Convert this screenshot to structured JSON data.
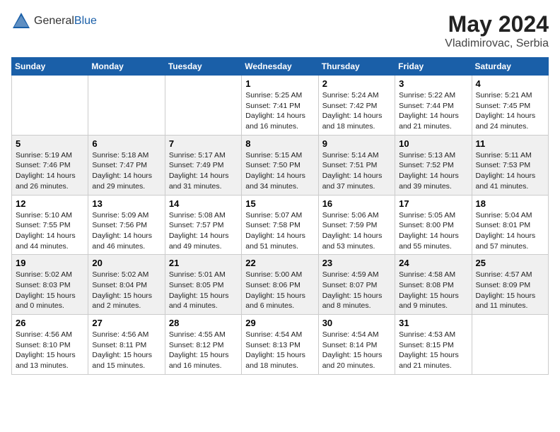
{
  "header": {
    "logo_general": "General",
    "logo_blue": "Blue",
    "month_year": "May 2024",
    "location": "Vladimirovac, Serbia"
  },
  "weekdays": [
    "Sunday",
    "Monday",
    "Tuesday",
    "Wednesday",
    "Thursday",
    "Friday",
    "Saturday"
  ],
  "weeks": [
    [
      {
        "day": "",
        "info": ""
      },
      {
        "day": "",
        "info": ""
      },
      {
        "day": "",
        "info": ""
      },
      {
        "day": "1",
        "info": "Sunrise: 5:25 AM\nSunset: 7:41 PM\nDaylight: 14 hours and 16 minutes."
      },
      {
        "day": "2",
        "info": "Sunrise: 5:24 AM\nSunset: 7:42 PM\nDaylight: 14 hours and 18 minutes."
      },
      {
        "day": "3",
        "info": "Sunrise: 5:22 AM\nSunset: 7:44 PM\nDaylight: 14 hours and 21 minutes."
      },
      {
        "day": "4",
        "info": "Sunrise: 5:21 AM\nSunset: 7:45 PM\nDaylight: 14 hours and 24 minutes."
      }
    ],
    [
      {
        "day": "5",
        "info": "Sunrise: 5:19 AM\nSunset: 7:46 PM\nDaylight: 14 hours and 26 minutes."
      },
      {
        "day": "6",
        "info": "Sunrise: 5:18 AM\nSunset: 7:47 PM\nDaylight: 14 hours and 29 minutes."
      },
      {
        "day": "7",
        "info": "Sunrise: 5:17 AM\nSunset: 7:49 PM\nDaylight: 14 hours and 31 minutes."
      },
      {
        "day": "8",
        "info": "Sunrise: 5:15 AM\nSunset: 7:50 PM\nDaylight: 14 hours and 34 minutes."
      },
      {
        "day": "9",
        "info": "Sunrise: 5:14 AM\nSunset: 7:51 PM\nDaylight: 14 hours and 37 minutes."
      },
      {
        "day": "10",
        "info": "Sunrise: 5:13 AM\nSunset: 7:52 PM\nDaylight: 14 hours and 39 minutes."
      },
      {
        "day": "11",
        "info": "Sunrise: 5:11 AM\nSunset: 7:53 PM\nDaylight: 14 hours and 41 minutes."
      }
    ],
    [
      {
        "day": "12",
        "info": "Sunrise: 5:10 AM\nSunset: 7:55 PM\nDaylight: 14 hours and 44 minutes."
      },
      {
        "day": "13",
        "info": "Sunrise: 5:09 AM\nSunset: 7:56 PM\nDaylight: 14 hours and 46 minutes."
      },
      {
        "day": "14",
        "info": "Sunrise: 5:08 AM\nSunset: 7:57 PM\nDaylight: 14 hours and 49 minutes."
      },
      {
        "day": "15",
        "info": "Sunrise: 5:07 AM\nSunset: 7:58 PM\nDaylight: 14 hours and 51 minutes."
      },
      {
        "day": "16",
        "info": "Sunrise: 5:06 AM\nSunset: 7:59 PM\nDaylight: 14 hours and 53 minutes."
      },
      {
        "day": "17",
        "info": "Sunrise: 5:05 AM\nSunset: 8:00 PM\nDaylight: 14 hours and 55 minutes."
      },
      {
        "day": "18",
        "info": "Sunrise: 5:04 AM\nSunset: 8:01 PM\nDaylight: 14 hours and 57 minutes."
      }
    ],
    [
      {
        "day": "19",
        "info": "Sunrise: 5:02 AM\nSunset: 8:03 PM\nDaylight: 15 hours and 0 minutes."
      },
      {
        "day": "20",
        "info": "Sunrise: 5:02 AM\nSunset: 8:04 PM\nDaylight: 15 hours and 2 minutes."
      },
      {
        "day": "21",
        "info": "Sunrise: 5:01 AM\nSunset: 8:05 PM\nDaylight: 15 hours and 4 minutes."
      },
      {
        "day": "22",
        "info": "Sunrise: 5:00 AM\nSunset: 8:06 PM\nDaylight: 15 hours and 6 minutes."
      },
      {
        "day": "23",
        "info": "Sunrise: 4:59 AM\nSunset: 8:07 PM\nDaylight: 15 hours and 8 minutes."
      },
      {
        "day": "24",
        "info": "Sunrise: 4:58 AM\nSunset: 8:08 PM\nDaylight: 15 hours and 9 minutes."
      },
      {
        "day": "25",
        "info": "Sunrise: 4:57 AM\nSunset: 8:09 PM\nDaylight: 15 hours and 11 minutes."
      }
    ],
    [
      {
        "day": "26",
        "info": "Sunrise: 4:56 AM\nSunset: 8:10 PM\nDaylight: 15 hours and 13 minutes."
      },
      {
        "day": "27",
        "info": "Sunrise: 4:56 AM\nSunset: 8:11 PM\nDaylight: 15 hours and 15 minutes."
      },
      {
        "day": "28",
        "info": "Sunrise: 4:55 AM\nSunset: 8:12 PM\nDaylight: 15 hours and 16 minutes."
      },
      {
        "day": "29",
        "info": "Sunrise: 4:54 AM\nSunset: 8:13 PM\nDaylight: 15 hours and 18 minutes."
      },
      {
        "day": "30",
        "info": "Sunrise: 4:54 AM\nSunset: 8:14 PM\nDaylight: 15 hours and 20 minutes."
      },
      {
        "day": "31",
        "info": "Sunrise: 4:53 AM\nSunset: 8:15 PM\nDaylight: 15 hours and 21 minutes."
      },
      {
        "day": "",
        "info": ""
      }
    ]
  ]
}
